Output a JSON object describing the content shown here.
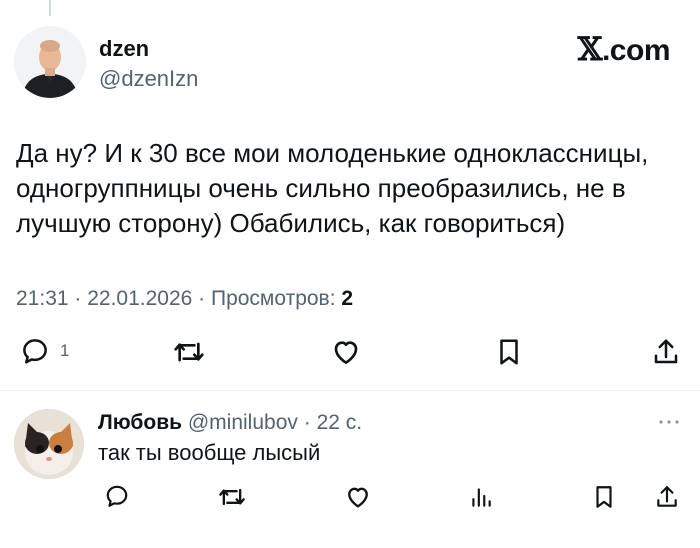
{
  "tweet": {
    "author_name": "dzen",
    "author_handle": "@dzenIzn",
    "brand": ".com",
    "brand_mark": "𝕏",
    "text": "Да ну? И к 30 все мои молоденькие одноклассницы, одногруппницы очень сильно преобразились, не в лучшую сторону) Обабились, как говориться)",
    "timestamp": "21:31 · 22.01.2026 · Просмотров: ",
    "views": "2",
    "reply_count": "1",
    "icons": [
      "reply-icon",
      "retweet-icon",
      "like-icon",
      "bookmark-icon",
      "share-icon"
    ]
  },
  "reply": {
    "author_name": "Любовь",
    "author_handle": "@minilubov",
    "separator": " · ",
    "time": "22 с.",
    "text": "так ты вообще лысый",
    "icons": [
      "reply-icon",
      "retweet-icon",
      "like-icon",
      "analytics-icon",
      "bookmark-icon",
      "share-icon",
      "more-icon"
    ]
  },
  "colors": {
    "text": "#0f1419",
    "secondary": "#536471",
    "divider": "#eff3f4"
  }
}
